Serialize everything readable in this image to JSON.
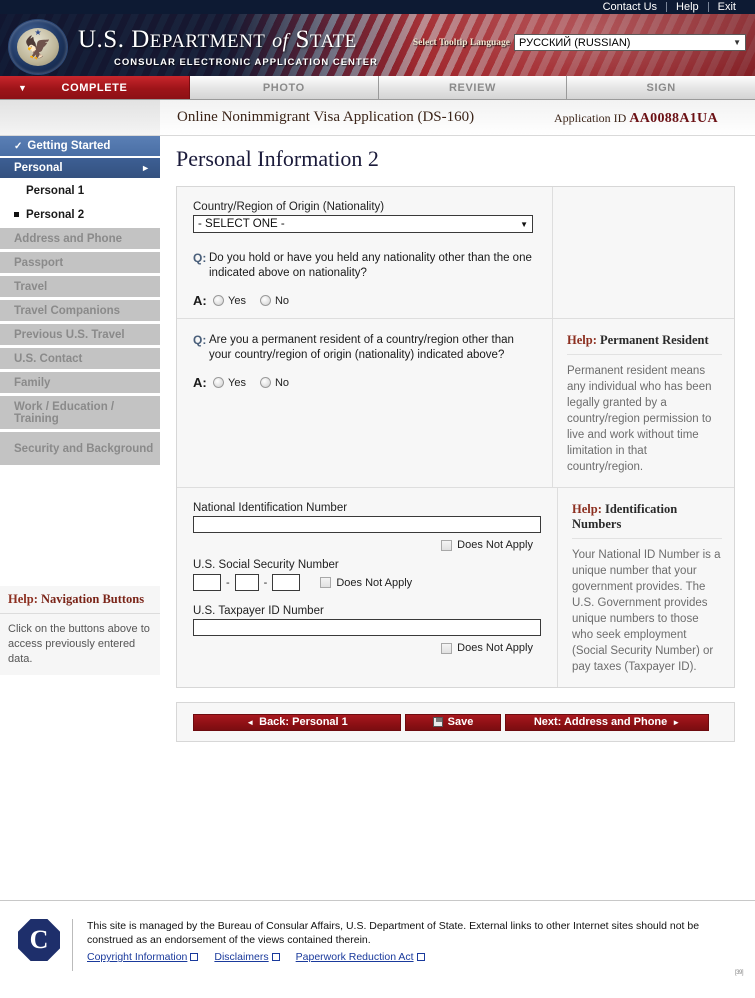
{
  "topbar": {
    "links": [
      {
        "label": "Contact Us",
        "name": "contact-us-link"
      },
      {
        "label": "Help",
        "name": "help-link"
      },
      {
        "label": "Exit",
        "name": "exit-link"
      }
    ]
  },
  "banner": {
    "title_us": "U.S. ",
    "title_dept": "D",
    "title_dept_rest": "EPARTMENT",
    "title_of": "of",
    "title_state_cap": "S",
    "title_state_rest": "TATE",
    "subtitle": "CONSULAR ELECTRONIC APPLICATION CENTER",
    "language_label": "Select Tooltip Language",
    "language_value": "РУССКИЙ (RUSSIAN)",
    "caret": "▼"
  },
  "stages": [
    {
      "label": "COMPLETE",
      "active": true
    },
    {
      "label": "PHOTO",
      "active": false
    },
    {
      "label": "REVIEW",
      "active": false
    },
    {
      "label": "SIGN",
      "active": false
    }
  ],
  "app_header": {
    "form_title": "Online Nonimmigrant Visa Application (DS-160)",
    "application_id_label": "Application ID ",
    "application_id_value": "AA0088A1UA"
  },
  "sidebar": {
    "items": [
      {
        "label": "Getting Started",
        "state": "done",
        "icon": "check-icon"
      },
      {
        "label": "Personal",
        "state": "current",
        "icon": "chevron-right-icon"
      },
      {
        "label": "Personal 1",
        "state": "sub"
      },
      {
        "label": "Personal 2",
        "state": "sub-active"
      },
      {
        "label": "Address and Phone",
        "state": "locked"
      },
      {
        "label": "Passport",
        "state": "locked"
      },
      {
        "label": "Travel",
        "state": "locked"
      },
      {
        "label": "Travel Companions",
        "state": "locked"
      },
      {
        "label": "Previous U.S. Travel",
        "state": "locked"
      },
      {
        "label": "U.S. Contact",
        "state": "locked"
      },
      {
        "label": "Family",
        "state": "locked"
      },
      {
        "label": "Work / Education / Training",
        "state": "locked"
      },
      {
        "label": "Security and Background",
        "state": "locked"
      }
    ],
    "help": {
      "title_prefix": "Help: ",
      "title": "Navigation Buttons",
      "body": "Click on the buttons above to access previously entered data."
    }
  },
  "page": {
    "title": "Personal Information 2"
  },
  "form": {
    "nationality": {
      "label": "Country/Region of Origin (Nationality)",
      "value": "- SELECT ONE -",
      "caret": "▼"
    },
    "q1": {
      "q_marker": "Q:",
      "text": "Do you hold or have you held any nationality other than the one indicated above on nationality?",
      "a_marker": "A:",
      "options": [
        "Yes",
        "No"
      ]
    },
    "q2": {
      "q_marker": "Q:",
      "text": "Are you a permanent resident of a country/region other than your country/region of origin (nationality) indicated above?",
      "a_marker": "A:",
      "options": [
        "Yes",
        "No"
      ]
    },
    "q2_help": {
      "title_prefix": "Help: ",
      "title": "Permanent Resident",
      "body": "Permanent resident means any individual who has been legally granted by a country/region permission to live and work without time limitation in that country/region."
    },
    "ids": {
      "national_id_label": "National Identification Number",
      "national_id_value": "",
      "national_id_dna": "Does Not Apply",
      "ssn_label": "U.S. Social Security Number",
      "ssn_part1": "",
      "ssn_part2": "",
      "ssn_part3": "",
      "ssn_dash": "-",
      "ssn_dna": "Does Not Apply",
      "taxpayer_label": "U.S. Taxpayer ID Number",
      "taxpayer_value": "",
      "taxpayer_dna": "Does Not Apply"
    },
    "ids_help": {
      "title_prefix": "Help: ",
      "title": "Identification Numbers",
      "body": "Your National ID Number is a unique number that your government provides. The U.S. Government provides unique numbers to those who seek employment (Social Security Number) or pay taxes (Taxpayer ID)."
    }
  },
  "buttons": {
    "back": "Back: Personal 1",
    "back_arrow": "◄",
    "save": "Save",
    "next": "Next: Address and Phone",
    "next_arrow": "►"
  },
  "footer": {
    "logo_letter": "C",
    "text": "This site is managed by the Bureau of Consular Affairs, U.S. Department of State. External links to other Internet sites should not be construed as an endorsement of the views contained therein.",
    "links": [
      {
        "label": "Copyright Information"
      },
      {
        "label": "Disclaimers"
      },
      {
        "label": "Paperwork Reduction Act"
      }
    ],
    "tiny_tag": "[39]"
  },
  "colors": {
    "brand_red": "#8c1014",
    "navy": "#0d1a33",
    "nav_blue": "#3d5f94",
    "help_red": "#8c2f20",
    "link_blue": "#1a3a9c"
  }
}
